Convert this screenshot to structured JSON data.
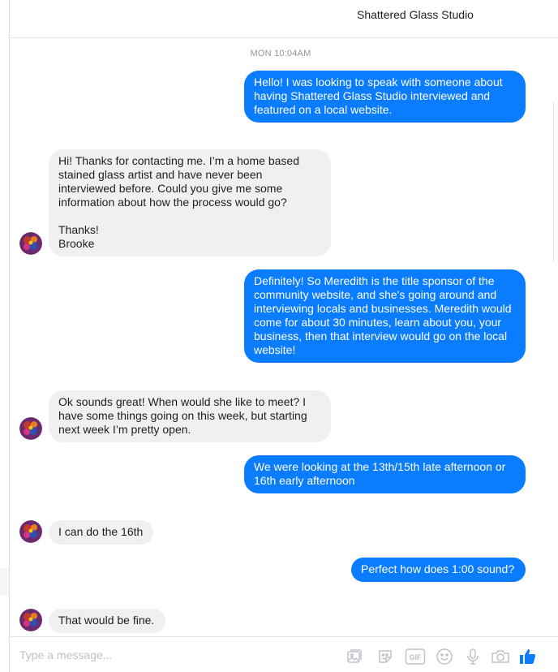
{
  "header": {
    "title": "Shattered Glass Studio"
  },
  "thread": {
    "timestamp": "MON 10:04AM",
    "messages": [
      {
        "from": "me",
        "text": "Hello! I was looking to speak with someone about having Shattered Glass Studio interviewed and featured on a local website."
      },
      {
        "from": "them",
        "text": "Hi! Thanks for contacting me. I’m a home based stained glass artist and have never been interviewed before. Could you give me some information about how the process would go?\n\nThanks!\nBrooke"
      },
      {
        "from": "me",
        "text": "Definitely! So Meredith is the title sponsor of the community website, and she's going around and interviewing locals and businesses. Meredith would come for about 30 minutes, learn about you, your business, then that interview would go on the local website!"
      },
      {
        "from": "them",
        "text": "Ok sounds great! When would she like to meet? I have some things going on this week, but starting next week I’m pretty open."
      },
      {
        "from": "me",
        "text": "We were looking at the 13th/15th late afternoon or 16th early afternoon"
      },
      {
        "from": "them",
        "text": "I can do the 16th"
      },
      {
        "from": "me",
        "text": "Perfect how does 1:00 sound?"
      },
      {
        "from": "them",
        "text": "That would be fine."
      }
    ]
  },
  "composer": {
    "placeholder": "Type a message...",
    "gif_label": "GIF",
    "icons": [
      "image-icon",
      "sticker-icon",
      "gif-icon",
      "emoji-icon",
      "microphone-icon",
      "camera-icon",
      "thumbs-up-icon"
    ]
  },
  "colors": {
    "accent": "#0a7cff",
    "incoming_bubble": "#f1f0f0",
    "muted_text": "#90949c",
    "divider": "#e5e5e5"
  }
}
